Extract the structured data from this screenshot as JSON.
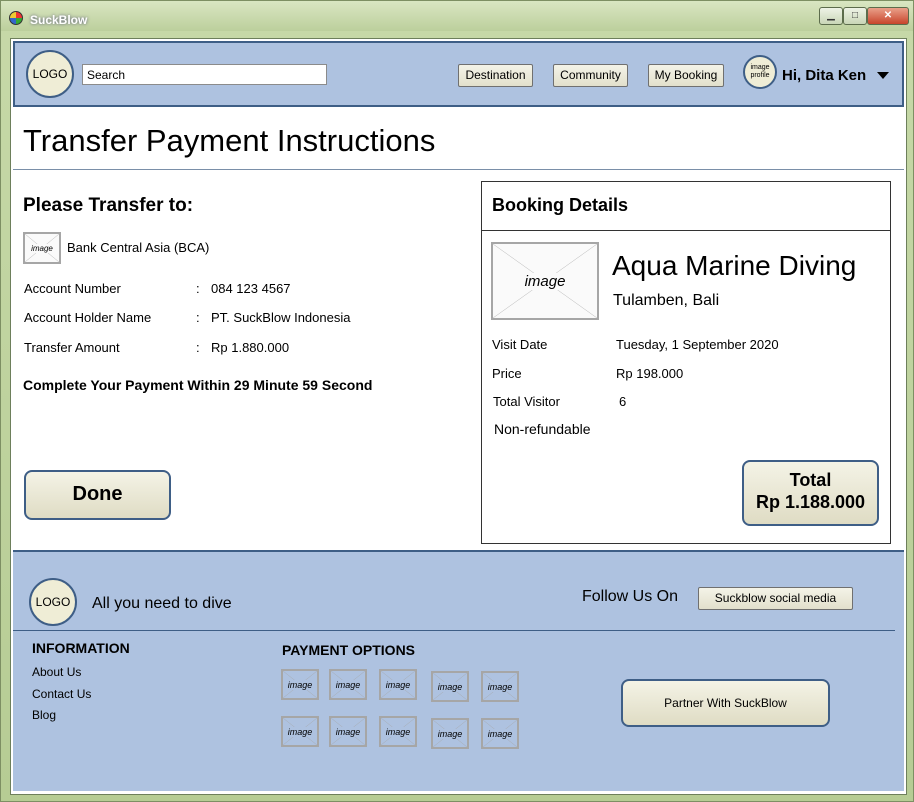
{
  "window": {
    "title": "SuckBlow",
    "minimize_glyph": "▁",
    "maximize_glyph": "□",
    "close_glyph": "✕"
  },
  "header": {
    "logo": "LOGO",
    "search_value": "Search",
    "nav": {
      "destination": "Destination",
      "community": "Community",
      "my_booking": "My Booking"
    },
    "avatar_text": "image profile",
    "greeting": "Hi, Dita Ken"
  },
  "page": {
    "title": "Transfer Payment Instructions"
  },
  "transfer": {
    "heading": "Please Transfer to:",
    "bank_image": "image",
    "bank_name": "Bank Central Asia (BCA)",
    "separator": ":",
    "fields": [
      {
        "label": "Account Number",
        "value": "084 123 4567"
      },
      {
        "label": "Account Holder Name",
        "value": "PT. SuckBlow Indonesia"
      },
      {
        "label": "Transfer Amount",
        "value": "Rp 1.880.000"
      }
    ],
    "countdown": "Complete Your Payment Within 29 Minute 59 Second",
    "done_label": "Done"
  },
  "booking": {
    "heading": "Booking Details",
    "image": "image",
    "destination": "Aqua Marine Diving",
    "location": "Tulamben, Bali",
    "rows": [
      {
        "label": "Visit Date",
        "value": "Tuesday, 1 September 2020"
      },
      {
        "label": "Price",
        "value": "Rp 198.000"
      },
      {
        "label": "Total Visitor",
        "value": "6"
      }
    ],
    "refund_note": "Non-refundable",
    "total_label": "Total",
    "total_value": "Rp 1.188.000"
  },
  "footer": {
    "logo": "LOGO",
    "tagline": "All you need to dive",
    "follow_label": "Follow Us On",
    "social_button": "Suckblow social media",
    "information_heading": "INFORMATION",
    "links": [
      "About Us",
      "Contact Us",
      "Blog"
    ],
    "payment_heading": "PAYMENT OPTIONS",
    "payment_image": "image",
    "partner_button": "Partner With SuckBlow"
  }
}
